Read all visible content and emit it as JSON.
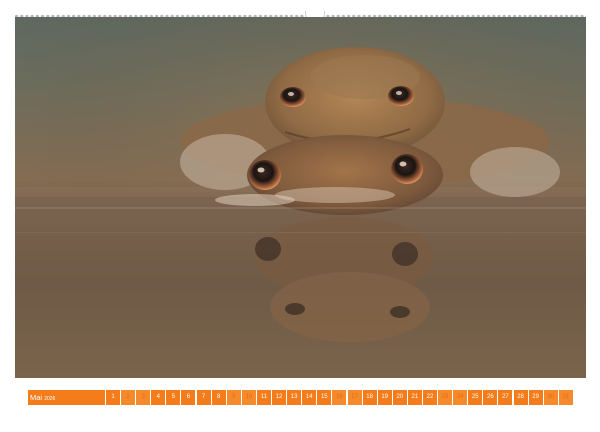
{
  "calendar": {
    "month_label": "Mai",
    "year": "2026",
    "days": [
      "1",
      "2",
      "3",
      "4",
      "5",
      "6",
      "7",
      "8",
      "9",
      "10",
      "11",
      "12",
      "13",
      "14",
      "15",
      "16",
      "17",
      "18",
      "19",
      "20",
      "21",
      "22",
      "23",
      "24",
      "25",
      "26",
      "27",
      "28",
      "29",
      "30",
      "31"
    ],
    "weekend_days": [
      "2",
      "3",
      "9",
      "10",
      "16",
      "17",
      "23",
      "24",
      "30",
      "31"
    ],
    "accent_color": "#f47c1a"
  },
  "photo": {
    "subject": "toad-pair-icon"
  }
}
